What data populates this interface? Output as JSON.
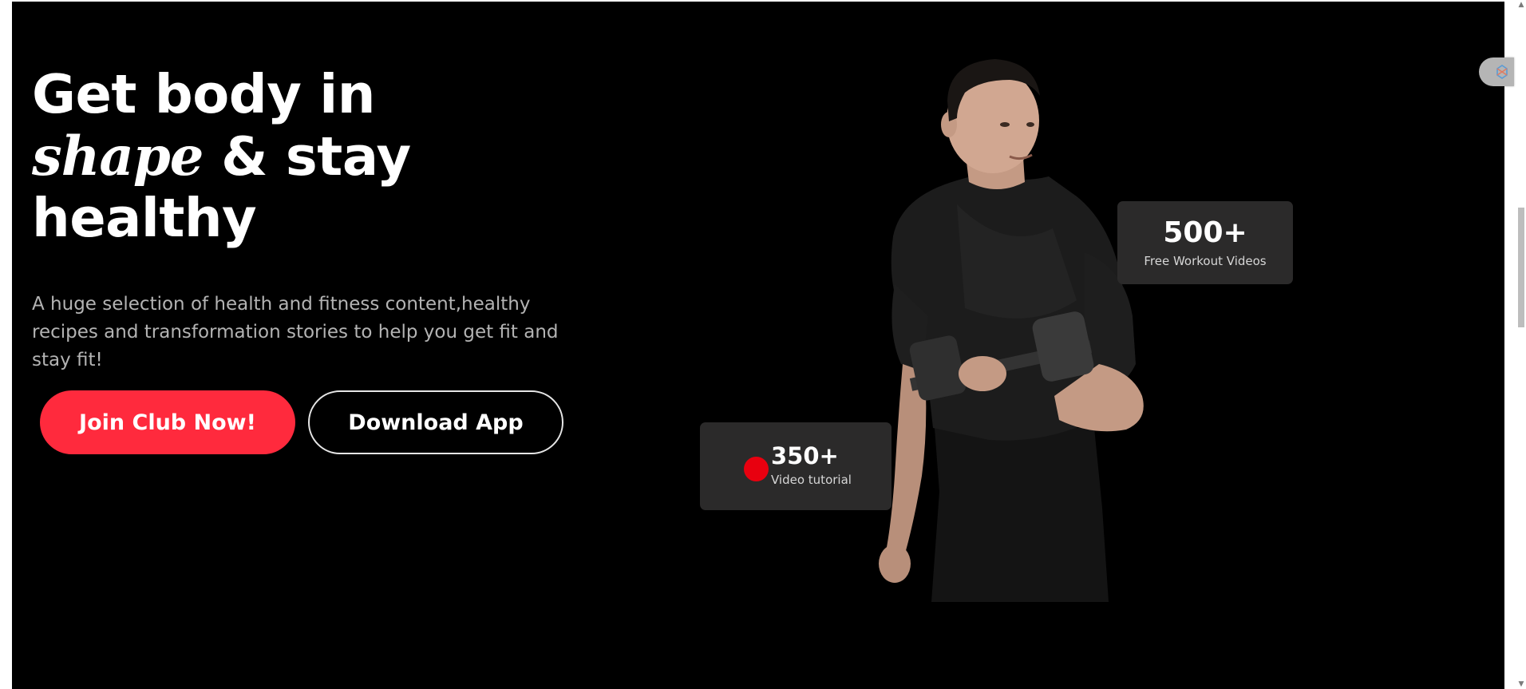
{
  "hero": {
    "title_line1": "Get body in",
    "title_em": "shape",
    "title_line2_rest": " & stay",
    "title_line3": "healthy",
    "description": "A huge selection of health and fitness content,healthy recipes and transformation stories to help you get fit and stay fit!",
    "join_button": "Join Club Now!",
    "download_button": "Download App"
  },
  "stats": {
    "videos_count": "500+",
    "videos_label": "Free Workout Videos",
    "tutorial_count": "350+",
    "tutorial_label": "Video tutorial"
  },
  "colors": {
    "background": "#000000",
    "accent": "#ff2a3d",
    "card": "#2b2a2a",
    "dot": "#e8000f",
    "muted_text": "#b3b3b3"
  },
  "icons": {
    "hero_image": "man-with-dumbbell-image",
    "tutorial_dot": "red-dot-icon",
    "extension": "extension-icon"
  }
}
